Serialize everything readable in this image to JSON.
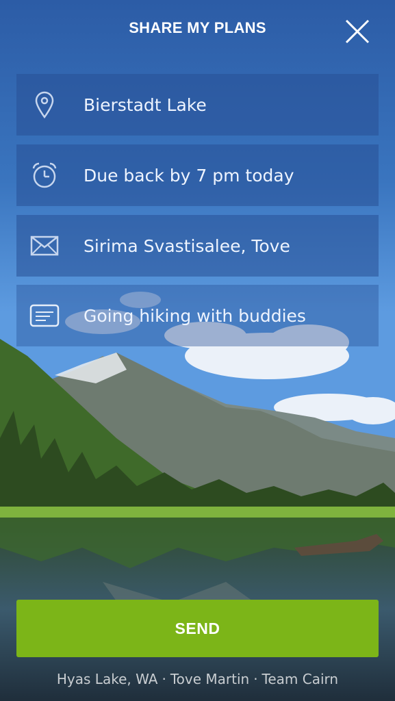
{
  "header": {
    "title": "SHARE MY PLANS"
  },
  "fields": [
    {
      "icon": "location-pin-icon",
      "text": "Bierstadt Lake"
    },
    {
      "icon": "alarm-clock-icon",
      "text": "Due back by 7 pm today"
    },
    {
      "icon": "envelope-icon",
      "text": "Sirima Svastisalee, Tove"
    },
    {
      "icon": "message-icon",
      "text": "Going hiking with buddies"
    }
  ],
  "actions": {
    "send_label": "SEND"
  },
  "credits": {
    "location": "Hyas Lake, WA",
    "separator": "·",
    "photographer": "Tove Martin",
    "team": "Team Cairn"
  },
  "colors": {
    "send_green": "#7cb518",
    "sky_blue": "#2b5a9a"
  }
}
